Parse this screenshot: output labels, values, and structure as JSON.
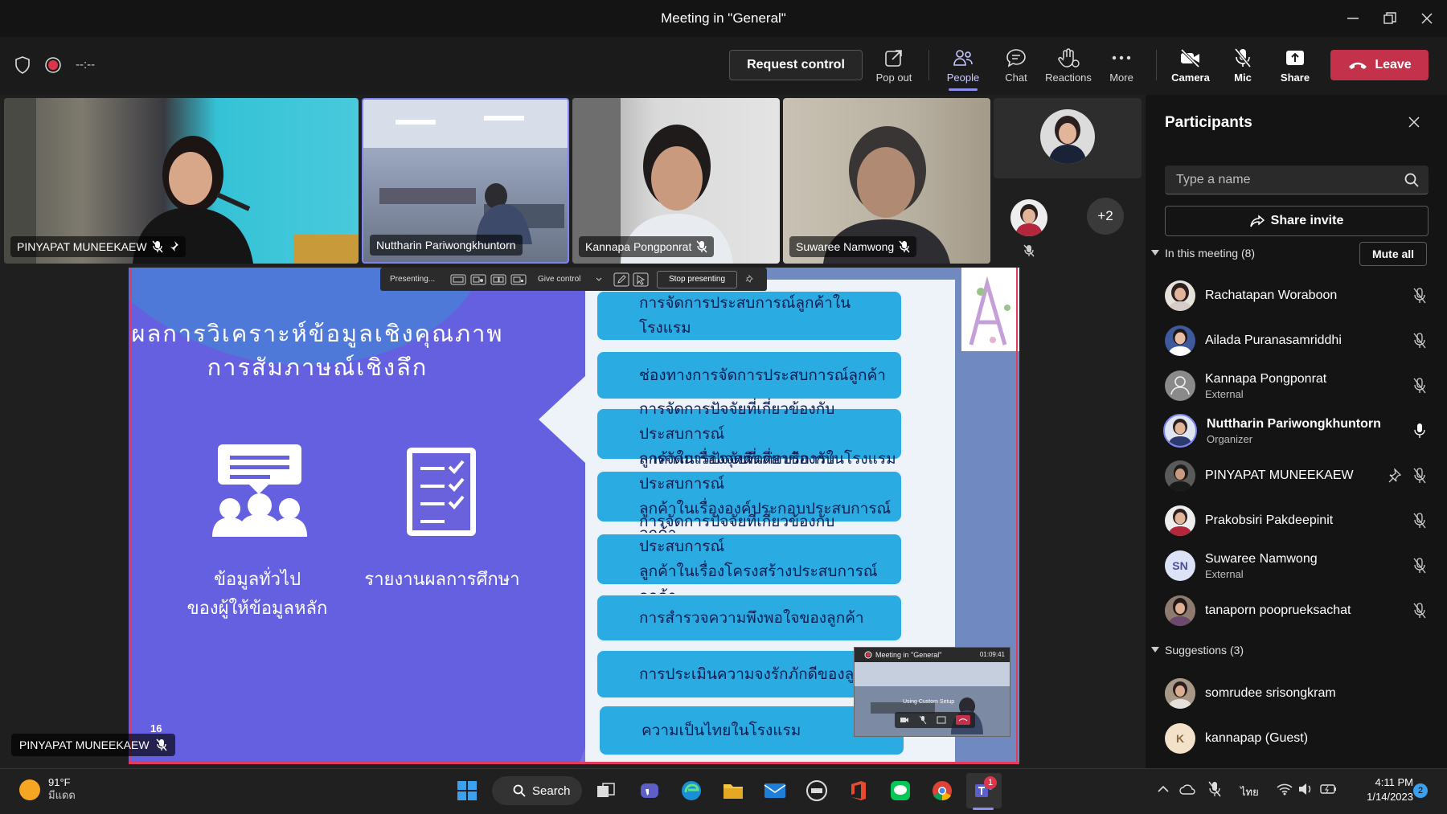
{
  "window": {
    "title": "Meeting in \"General\""
  },
  "meeting": {
    "timer": "--:--"
  },
  "toolbar": {
    "request_control": "Request control",
    "pop_out": "Pop out",
    "people": "People",
    "chat": "Chat",
    "reactions": "Reactions",
    "more": "More",
    "camera": "Camera",
    "mic": "Mic",
    "share": "Share",
    "leave": "Leave"
  },
  "tiles": [
    {
      "name": "PINYAPAT MUNEEKAEW"
    },
    {
      "name": "Nuttharin Pariwongkhuntorn"
    },
    {
      "name": "Kannapa Pongponrat"
    },
    {
      "name": "Suwaree Namwong"
    }
  ],
  "overflow": {
    "count": "+2"
  },
  "presenter_bar": {
    "status": "Presenting...",
    "give_control": "Give control",
    "stop": "Stop presenting"
  },
  "slide": {
    "title_line1": "ผลการวิเคราะห์ข้อมูลเชิงคุณภาพ",
    "title_line2": "การสัมภาษณ์เชิงลึก",
    "left_caption_1": "ข้อมูลทั่วไป",
    "left_caption_2": "ของผู้ให้ข้อมูลหลัก",
    "right_caption": "รายงานผลการศึกษา",
    "page_number": "16",
    "items": [
      {
        "line1": "การจัดการประสบการณ์ลูกค้าในโรงแรม",
        "line2": ""
      },
      {
        "line1": "ช่องทางการจัดการประสบการณ์ลูกค้า",
        "line2": ""
      },
      {
        "line1": "การจัดการปัจจัยที่เกี่ยวข้องกับประสบการณ์",
        "line2": "ลูกค้าในเรื่องจุดติดต่อบริการในโรงแรม"
      },
      {
        "line1": "การจัดการปัจจัยที่เกี่ยวข้องกับประสบการณ์",
        "line2": "ลูกค้าในเรื่ององค์ประกอบประสบการณ์ลูกค้า"
      },
      {
        "line1": "การจัดการปัจจัยที่เกี่ยวข้องกับประสบการณ์",
        "line2": "ลูกค้าในเรื่องโครงสร้างประสบการณ์ลูกค้า"
      },
      {
        "line1": "การสำรวจความพึงพอใจของลูกค้า",
        "line2": ""
      },
      {
        "line1": "การประเมินความจงรักภักดีของลูกค้า",
        "line2": ""
      },
      {
        "line1": "ความเป็นไทยในโรงแรม",
        "line2": ""
      }
    ]
  },
  "stage_label": {
    "name": "PINYAPAT MUNEEKAEW"
  },
  "mini_window": {
    "title": "Meeting in \"General\"",
    "time": "01:09:41",
    "note": "Using Custom Setup"
  },
  "participants": {
    "title": "Participants",
    "search_placeholder": "Type a name",
    "share_invite": "Share invite",
    "in_meeting": "In this meeting (8)",
    "mute_all": "Mute all",
    "list": [
      {
        "name": "Rachatapan Woraboon",
        "role": ""
      },
      {
        "name": "Ailada Puranasamriddhi",
        "role": ""
      },
      {
        "name": "Kannapa Pongponrat",
        "role": "External"
      },
      {
        "name": "Nuttharin Pariwongkhuntorn",
        "role": "Organizer"
      },
      {
        "name": "PINYAPAT MUNEEKAEW",
        "role": ""
      },
      {
        "name": "Prakobsiri Pakdeepinit",
        "role": ""
      },
      {
        "name": "Suwaree Namwong",
        "role": "External",
        "initials": "SN"
      },
      {
        "name": "tanaporn pooprueksachat",
        "role": ""
      }
    ],
    "suggestions": "Suggestions (3)",
    "suggestion_list": [
      {
        "name": "somrudee srisongkram"
      },
      {
        "name": "kannapap (Guest)",
        "initials": "K"
      }
    ]
  },
  "taskbar": {
    "temperature": "91°F",
    "weather_text": "มีแดด",
    "search": "Search",
    "language": "ไทย",
    "time": "4:11 PM",
    "date": "1/14/2023",
    "notification_count": "2",
    "teams_badge": "1"
  }
}
